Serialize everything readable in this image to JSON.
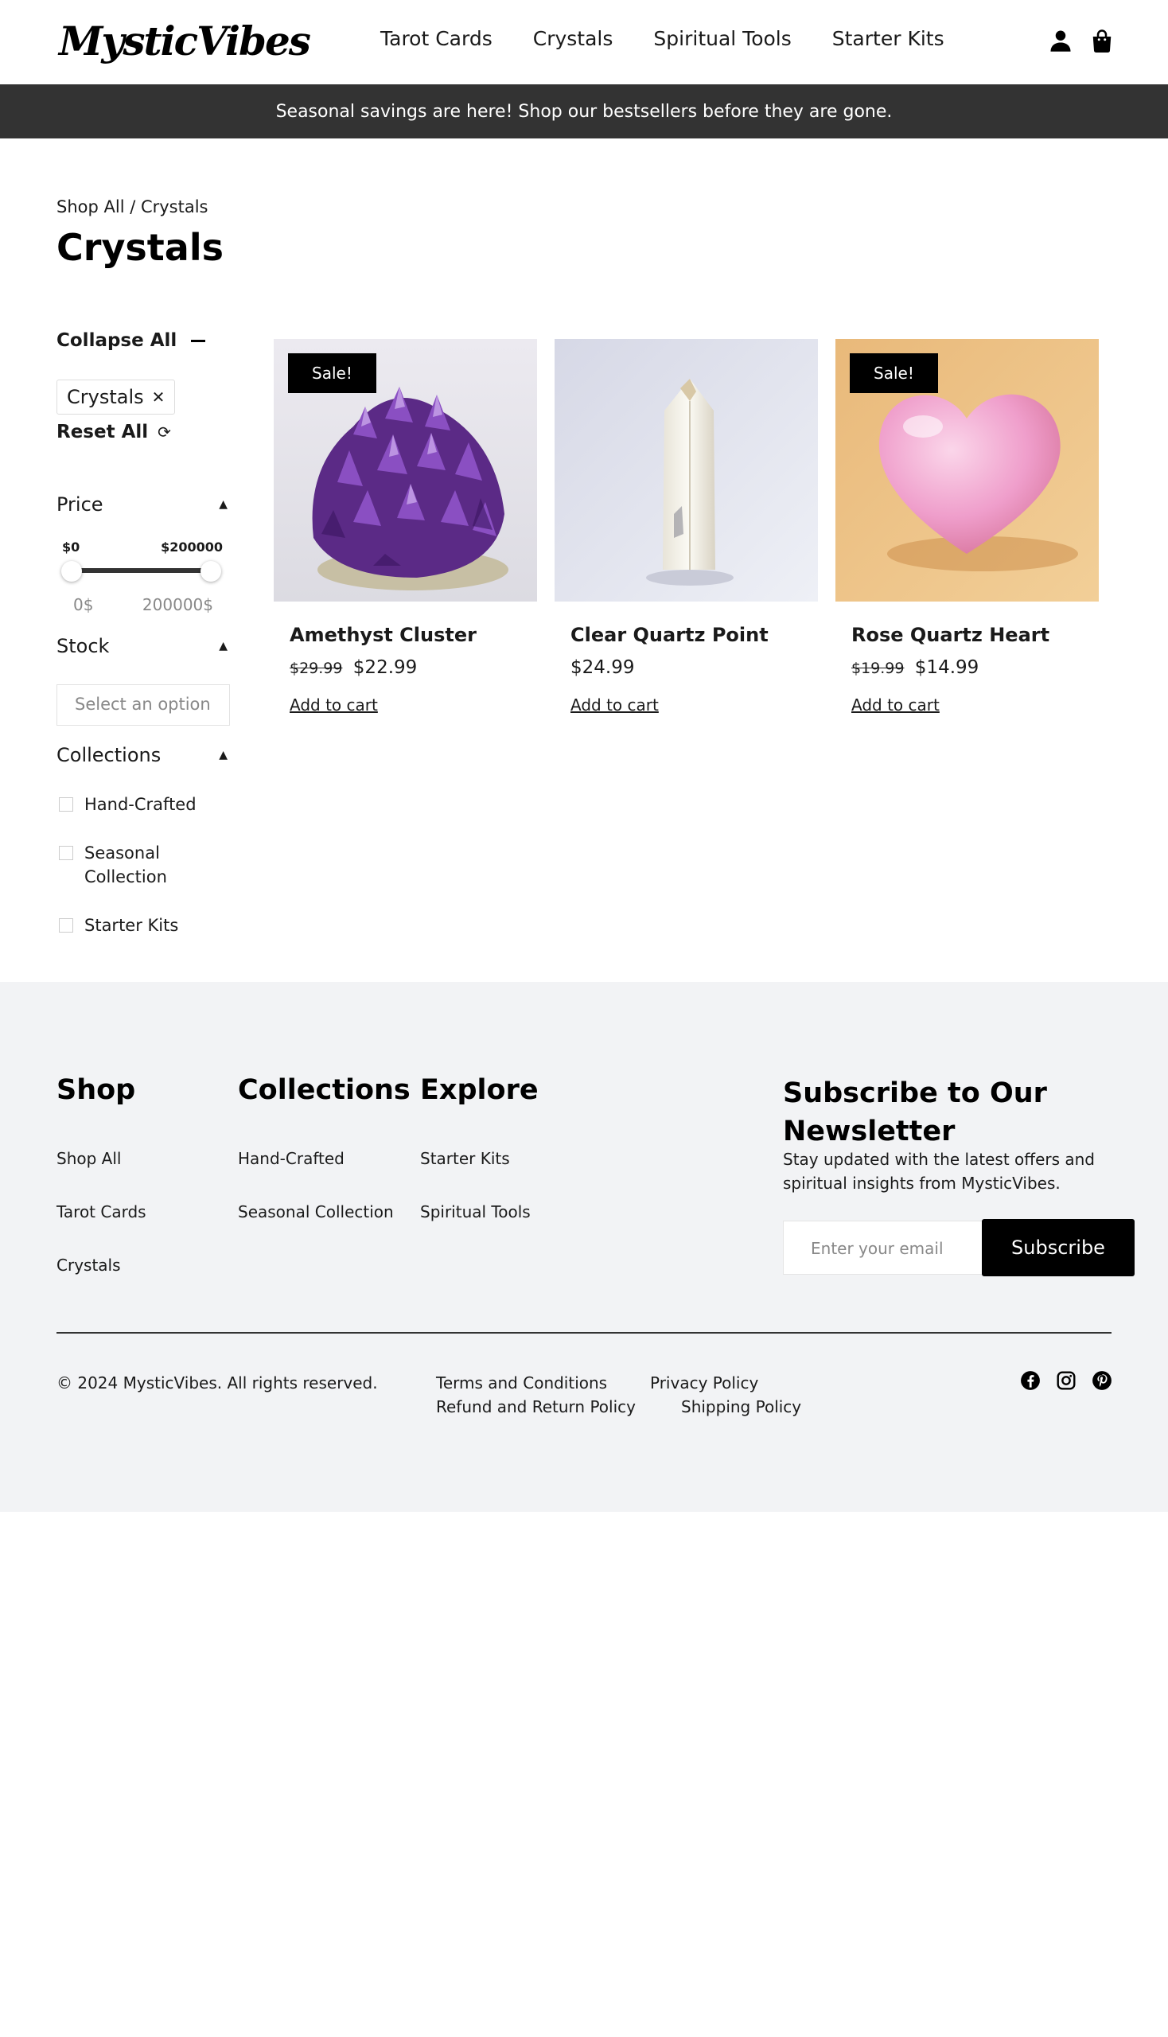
{
  "header": {
    "logo": "MysticVibes",
    "nav": [
      "Tarot Cards",
      "Crystals",
      "Spiritual Tools",
      "Starter Kits"
    ],
    "icons": [
      "user-icon",
      "shopping-bag-icon"
    ]
  },
  "announcement": "Seasonal savings are here! Shop our bestsellers before they are gone.",
  "breadcrumb": "Shop All / Crystals",
  "page_title": "Crystals",
  "filters": {
    "collapse_all": "Collapse All",
    "active_chip": "Crystals",
    "chip_remove": "✕",
    "reset_all": "Reset All",
    "price": {
      "label": "Price",
      "min_label": "$0",
      "max_label": "$200000",
      "range_min": "0$",
      "range_max": "200000$"
    },
    "stock": {
      "label": "Stock",
      "placeholder": "Select an option"
    },
    "collections": {
      "label": "Collections",
      "options": [
        "Hand-Crafted",
        "Seasonal Collection",
        "Starter Kits"
      ]
    }
  },
  "products": [
    {
      "name": "Amethyst Cluster",
      "badge": "Sale!",
      "old_price": "$29.99",
      "price": "$22.99",
      "cta": "Add to cart"
    },
    {
      "name": "Clear Quartz Point",
      "badge": "",
      "old_price": "",
      "price": "$24.99",
      "cta": "Add to cart"
    },
    {
      "name": "Rose Quartz Heart",
      "badge": "Sale!",
      "old_price": "$19.99",
      "price": "$14.99",
      "cta": "Add to cart"
    }
  ],
  "footer": {
    "shop": {
      "title": "Shop",
      "links": [
        "Shop All",
        "Tarot Cards",
        "Crystals"
      ]
    },
    "collections": {
      "title": "Collections",
      "links": [
        "Hand-Crafted",
        "Seasonal Collection"
      ]
    },
    "explore": {
      "title": "Explore",
      "links": [
        "Starter Kits",
        "Spiritual Tools"
      ]
    },
    "newsletter": {
      "title": "Subscribe to Our Newsletter",
      "text": "Stay updated with the latest offers and spiritual insights from MysticVibes.",
      "placeholder": "Enter your email",
      "button": "Subscribe"
    },
    "copyright": "© 2024 MysticVibes. All rights reserved.",
    "legal": [
      "Terms and Conditions",
      "Privacy Policy",
      "Refund and Return Policy",
      "Shipping Policy"
    ],
    "social": [
      "facebook-icon",
      "instagram-icon",
      "pinterest-icon"
    ]
  },
  "colors": {
    "announcement_bg": "#333333",
    "footer_bg": "#f2f3f5",
    "badge_bg": "#000000"
  }
}
